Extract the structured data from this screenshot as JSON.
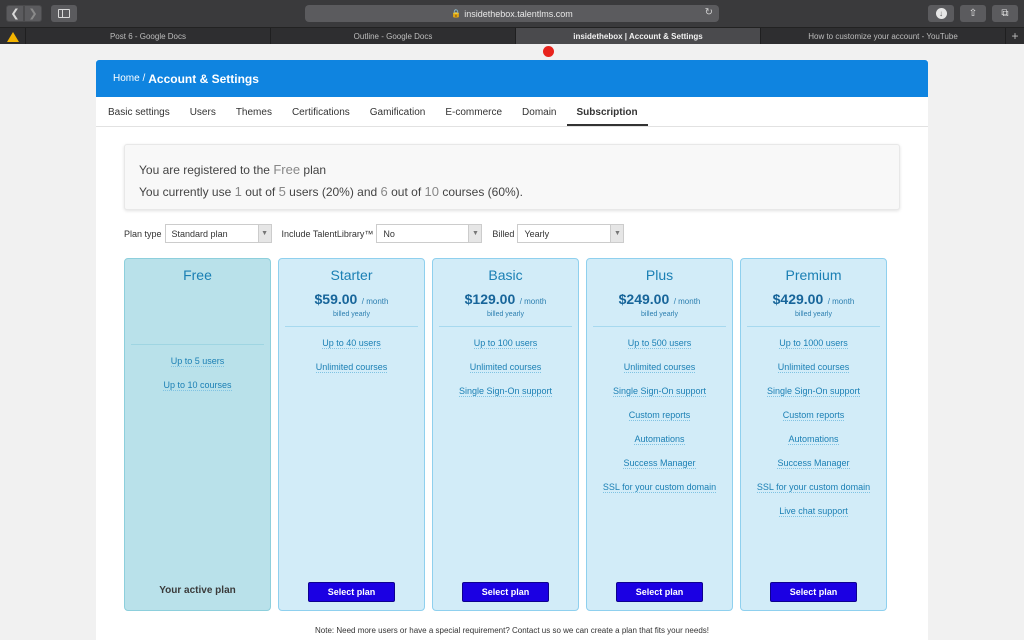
{
  "browser": {
    "url": "insidethebox.talentlms.com",
    "tabs": [
      {
        "label": "Post 6 - Google Docs",
        "active": false
      },
      {
        "label": "Outline - Google Docs",
        "active": false
      },
      {
        "label": "insidethebox | Account & Settings",
        "active": true
      },
      {
        "label": "How to customize your account - YouTube",
        "active": false
      }
    ],
    "icons": {
      "back": "chevron-left-icon",
      "forward": "chevron-right-icon",
      "sidebar": "sidebar-icon",
      "lock": "lock-icon",
      "reload": "reload-icon",
      "download": "download-icon",
      "share": "share-icon",
      "tabs": "tab-overview-icon",
      "new_tab": "plus-icon",
      "drive": "google-drive-icon"
    }
  },
  "header": {
    "home": "Home",
    "separator": "/",
    "title": "Account & Settings"
  },
  "nav_tabs": [
    "Basic settings",
    "Users",
    "Themes",
    "Certifications",
    "Gamification",
    "E-commerce",
    "Domain",
    "Subscription"
  ],
  "active_tab": "Subscription",
  "info": {
    "line1_prefix": "You are registered to the",
    "plan_name": "Free",
    "line1_suffix": "plan",
    "line2_a": "You currently use",
    "users_used": "1",
    "line2_b": "out of",
    "users_total": "5",
    "line2_c": "users (20%) and",
    "courses_used": "6",
    "line2_d": "out of",
    "courses_total": "10",
    "line2_e": "courses (60%)."
  },
  "filters": {
    "plan_type_label": "Plan type",
    "plan_type_value": "Standard plan",
    "talentlibrary_label": "Include TalentLibrary™",
    "talentlibrary_value": "No",
    "billed_label": "Billed",
    "billed_value": "Yearly"
  },
  "plans": [
    {
      "name": "Free",
      "price": "",
      "per": "",
      "billed": "",
      "features": [
        "Up to 5 users",
        "Up to 10 courses"
      ],
      "active_label": "Your active plan",
      "button": ""
    },
    {
      "name": "Starter",
      "price": "$59.00",
      "per": "/ month",
      "billed": "billed yearly",
      "features": [
        "Up to 40 users",
        "Unlimited courses"
      ],
      "active_label": "",
      "button": "Select plan"
    },
    {
      "name": "Basic",
      "price": "$129.00",
      "per": "/ month",
      "billed": "billed yearly",
      "features": [
        "Up to 100 users",
        "Unlimited courses",
        "Single Sign-On support"
      ],
      "active_label": "",
      "button": "Select plan"
    },
    {
      "name": "Plus",
      "price": "$249.00",
      "per": "/ month",
      "billed": "billed yearly",
      "features": [
        "Up to 500 users",
        "Unlimited courses",
        "Single Sign-On support",
        "Custom reports",
        "Automations",
        "Success Manager",
        "SSL for your custom domain"
      ],
      "active_label": "",
      "button": "Select plan"
    },
    {
      "name": "Premium",
      "price": "$429.00",
      "per": "/ month",
      "billed": "billed yearly",
      "features": [
        "Up to 1000 users",
        "Unlimited courses",
        "Single Sign-On support",
        "Custom reports",
        "Automations",
        "Success Manager",
        "SSL for your custom domain",
        "Live chat support"
      ],
      "active_label": "",
      "button": "Select plan"
    }
  ],
  "note": "Note: Need more users or have a special requirement? Contact us so we can create a plan that fits your needs!",
  "colors": {
    "header": "#0f84e0",
    "plan_bg": "#d2ecf8",
    "free_bg": "#b9e1ea",
    "button": "#1b00e3",
    "plan_text": "#1a7fb4"
  }
}
